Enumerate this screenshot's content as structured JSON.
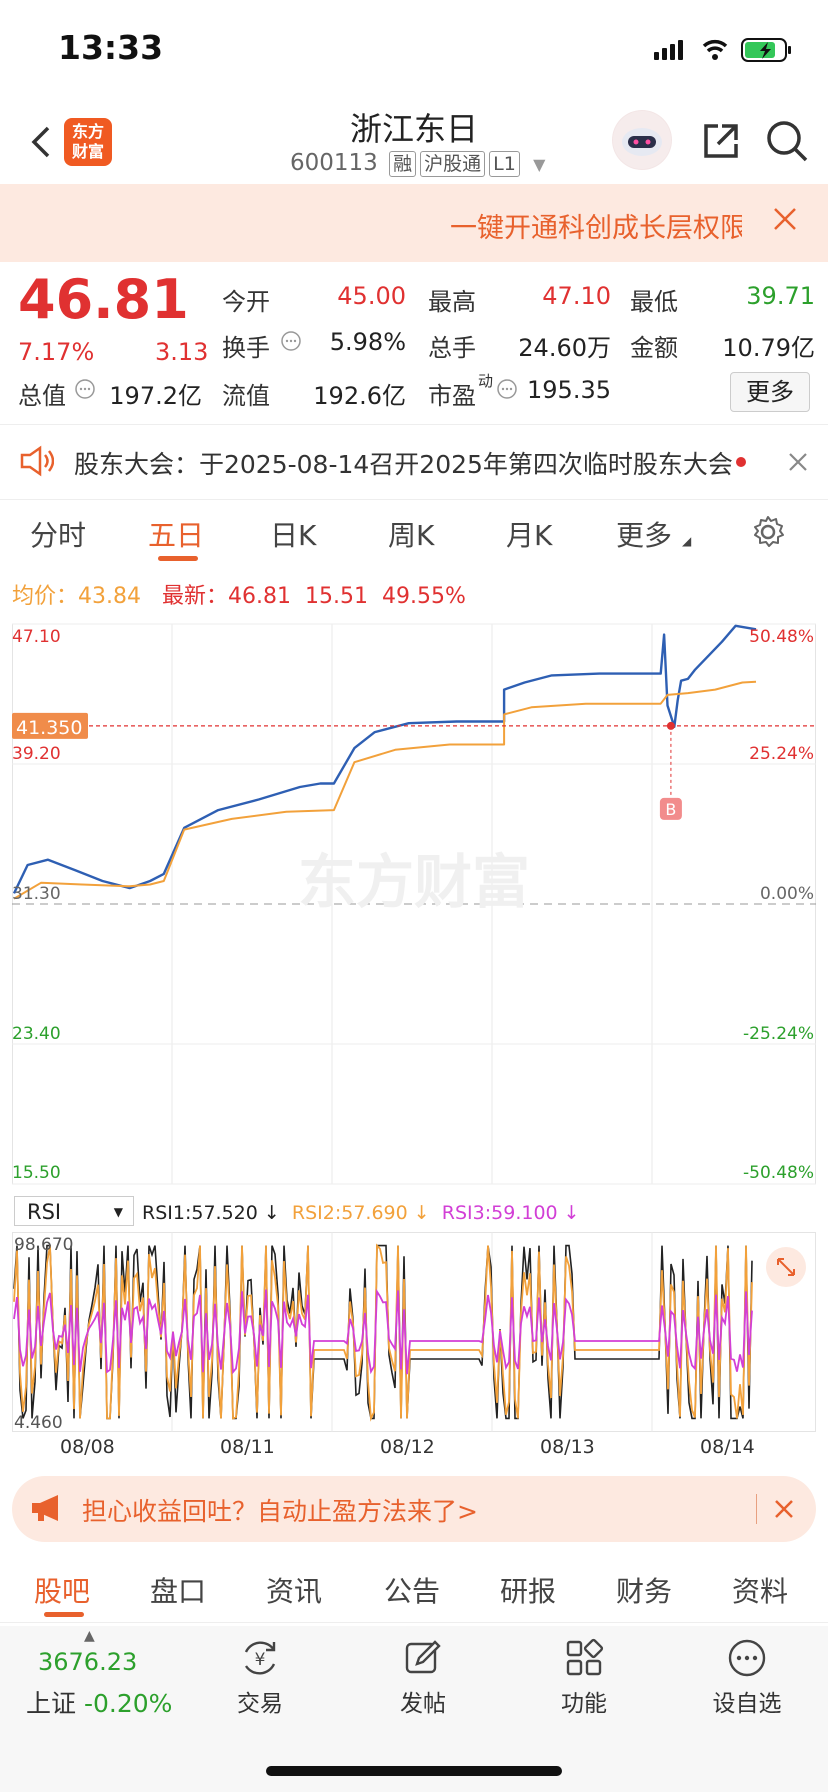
{
  "status": {
    "time": "13:33"
  },
  "header": {
    "title": "浙江东日",
    "code": "600113",
    "tags": [
      "融",
      "沪股通",
      "L1"
    ],
    "logo_text": "东方财富"
  },
  "banner": {
    "text": "一键开通科创成长层权限"
  },
  "quote": {
    "price": "46.81",
    "change_pct": "7.17%",
    "change": "3.13",
    "fields": [
      {
        "label": "今开",
        "value": "45.00",
        "color": "red"
      },
      {
        "label": "最高",
        "value": "47.10",
        "color": "red"
      },
      {
        "label": "最低",
        "value": "39.71",
        "color": "green"
      },
      {
        "label": "换手",
        "value": "5.98%",
        "color": "dark"
      },
      {
        "label": "总手",
        "value": "24.60万",
        "color": "dark"
      },
      {
        "label": "金额",
        "value": "10.79亿",
        "color": "dark"
      },
      {
        "label": "总值",
        "value": "197.2亿",
        "color": "dark"
      },
      {
        "label": "流值",
        "value": "192.6亿",
        "color": "dark"
      },
      {
        "label": "市盈",
        "label_sup": "动",
        "value": "195.35",
        "color": "dark"
      }
    ],
    "more": "更多"
  },
  "notice": {
    "text": "股东大会：于2025-08-14召开2025年第四次临时股东大会"
  },
  "tabs": [
    "分时",
    "五日",
    "日K",
    "周K",
    "月K",
    "更多"
  ],
  "info_bar": {
    "avg_label": "均价：",
    "avg": "43.84",
    "latest_label": "最新：",
    "latest": "46.81",
    "change": "15.51",
    "change_pct": "49.55%"
  },
  "chart_data": {
    "type": "line",
    "y_ticks_left": [
      "47.10",
      "39.20",
      "31.30",
      "23.40",
      "15.50"
    ],
    "y_ticks_right": [
      "50.48%",
      "25.24%",
      "0.00%",
      "-25.24%",
      "-50.48%"
    ],
    "ylim": [
      15.5,
      47.1
    ],
    "baseline": "31.30",
    "crosshair_label": "41.350",
    "marker": "B",
    "days": [
      "08/08",
      "08/11",
      "08/12",
      "08/13",
      "08/14"
    ],
    "series": [
      {
        "name": "",
        "color": "#2e5fb3",
        "points": [
          [
            0,
            31.9
          ],
          [
            0.02,
            33.5
          ],
          [
            0.05,
            33.8
          ],
          [
            0.09,
            33.2
          ],
          [
            0.13,
            32.6
          ],
          [
            0.17,
            32.2
          ],
          [
            0.2,
            32.6
          ],
          [
            0.22,
            33.0
          ],
          [
            0.25,
            35.6
          ],
          [
            0.3,
            36.6
          ],
          [
            0.36,
            37.2
          ],
          [
            0.42,
            37.9
          ],
          [
            0.45,
            38.1
          ],
          [
            0.47,
            38.1
          ],
          [
            0.5,
            40.1
          ],
          [
            0.53,
            41.0
          ],
          [
            0.58,
            41.5
          ],
          [
            0.65,
            41.6
          ],
          [
            0.7,
            41.6
          ],
          [
            0.72,
            41.6
          ],
          [
            0.72,
            43.4
          ],
          [
            0.75,
            43.8
          ],
          [
            0.79,
            44.2
          ],
          [
            0.86,
            44.3
          ],
          [
            0.93,
            44.3
          ],
          [
            0.95,
            44.3
          ],
          [
            0.955,
            46.5
          ],
          [
            0.96,
            42.5
          ],
          [
            0.97,
            41.3
          ],
          [
            0.975,
            42.8
          ],
          [
            0.98,
            43.9
          ],
          [
            0.99,
            44.0
          ],
          [
            1.0,
            44.5
          ],
          [
            1.02,
            45.3
          ],
          [
            1.04,
            46.1
          ],
          [
            1.06,
            47.0
          ],
          [
            1.09,
            46.8
          ]
        ]
      },
      {
        "name": "",
        "color": "#f2a13b",
        "points": [
          [
            0,
            31.6
          ],
          [
            0.04,
            32.5
          ],
          [
            0.1,
            32.4
          ],
          [
            0.17,
            32.3
          ],
          [
            0.2,
            32.4
          ],
          [
            0.22,
            32.6
          ],
          [
            0.25,
            35.5
          ],
          [
            0.32,
            36.1
          ],
          [
            0.4,
            36.5
          ],
          [
            0.47,
            36.6
          ],
          [
            0.5,
            39.3
          ],
          [
            0.56,
            40.0
          ],
          [
            0.64,
            40.3
          ],
          [
            0.72,
            40.3
          ],
          [
            0.72,
            42.0
          ],
          [
            0.76,
            42.4
          ],
          [
            0.84,
            42.6
          ],
          [
            0.95,
            42.6
          ],
          [
            0.96,
            43.1
          ],
          [
            0.99,
            43.2
          ],
          [
            1.03,
            43.4
          ],
          [
            1.07,
            43.8
          ],
          [
            1.09,
            43.84
          ]
        ]
      }
    ]
  },
  "indicator": {
    "select": "RSI",
    "rsi1": "RSI1:57.520 ↓",
    "rsi2": "RSI2:57.690 ↓",
    "rsi3": "RSI3:59.100 ↓",
    "max": "98.670",
    "min": "4.460"
  },
  "promo": {
    "text": "担心收益回吐？自动止盈方法来了>"
  },
  "bottom_tabs": [
    "股吧",
    "盘口",
    "资讯",
    "公告",
    "研报",
    "财务",
    "资料"
  ],
  "dock": {
    "index_value": "3676.23",
    "index_name": "上证",
    "index_change": "-0.20%",
    "items": [
      "交易",
      "发帖",
      "功能",
      "设自选"
    ]
  },
  "colors": {
    "up": "#e03131",
    "down": "#2ca02c",
    "accent": "#e8612d",
    "price_line": "#2e5fb3",
    "avg_line": "#f2a13b"
  }
}
